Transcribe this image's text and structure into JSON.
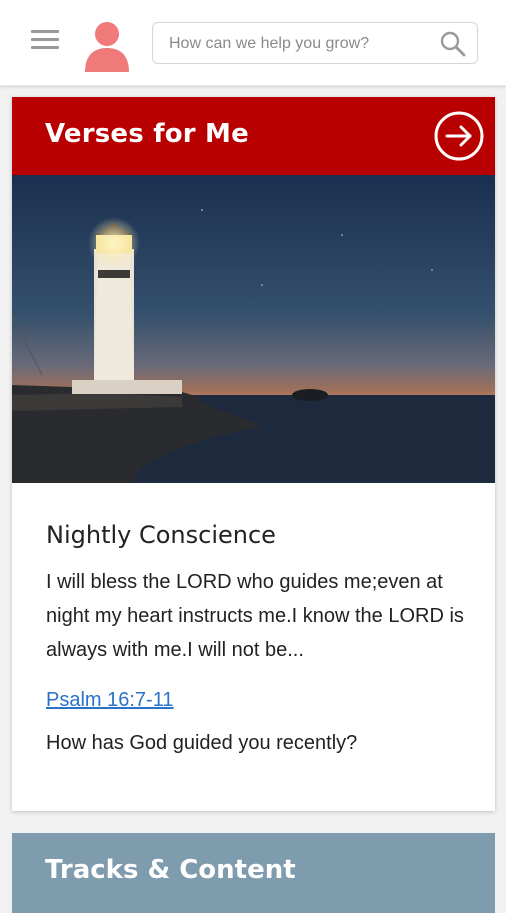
{
  "header": {
    "menu_icon": "hamburger-menu-icon",
    "avatar_icon": "user-avatar-icon",
    "search": {
      "placeholder": "How can we help you grow?",
      "value": "",
      "icon": "search-icon"
    }
  },
  "verses_card": {
    "title": "Verses for Me",
    "action_icon": "arrow-right-circle-icon",
    "header_color": "#b90000",
    "image_subject": "lighthouse",
    "verse_title": "Nightly Conscience",
    "verse_text": "I will bless the LORD who guides me;even at night my heart instructs me.I know the LORD is always with me.I will not be...",
    "reference": "Psalm 16:7-11",
    "question": "How has God guided you recently?"
  },
  "tracks_card": {
    "title": "Tracks & Content",
    "header_color": "#7f9cae"
  },
  "colors": {
    "accent": "#b90000",
    "avatar": "#f07a7a",
    "link": "#2a72c9"
  }
}
